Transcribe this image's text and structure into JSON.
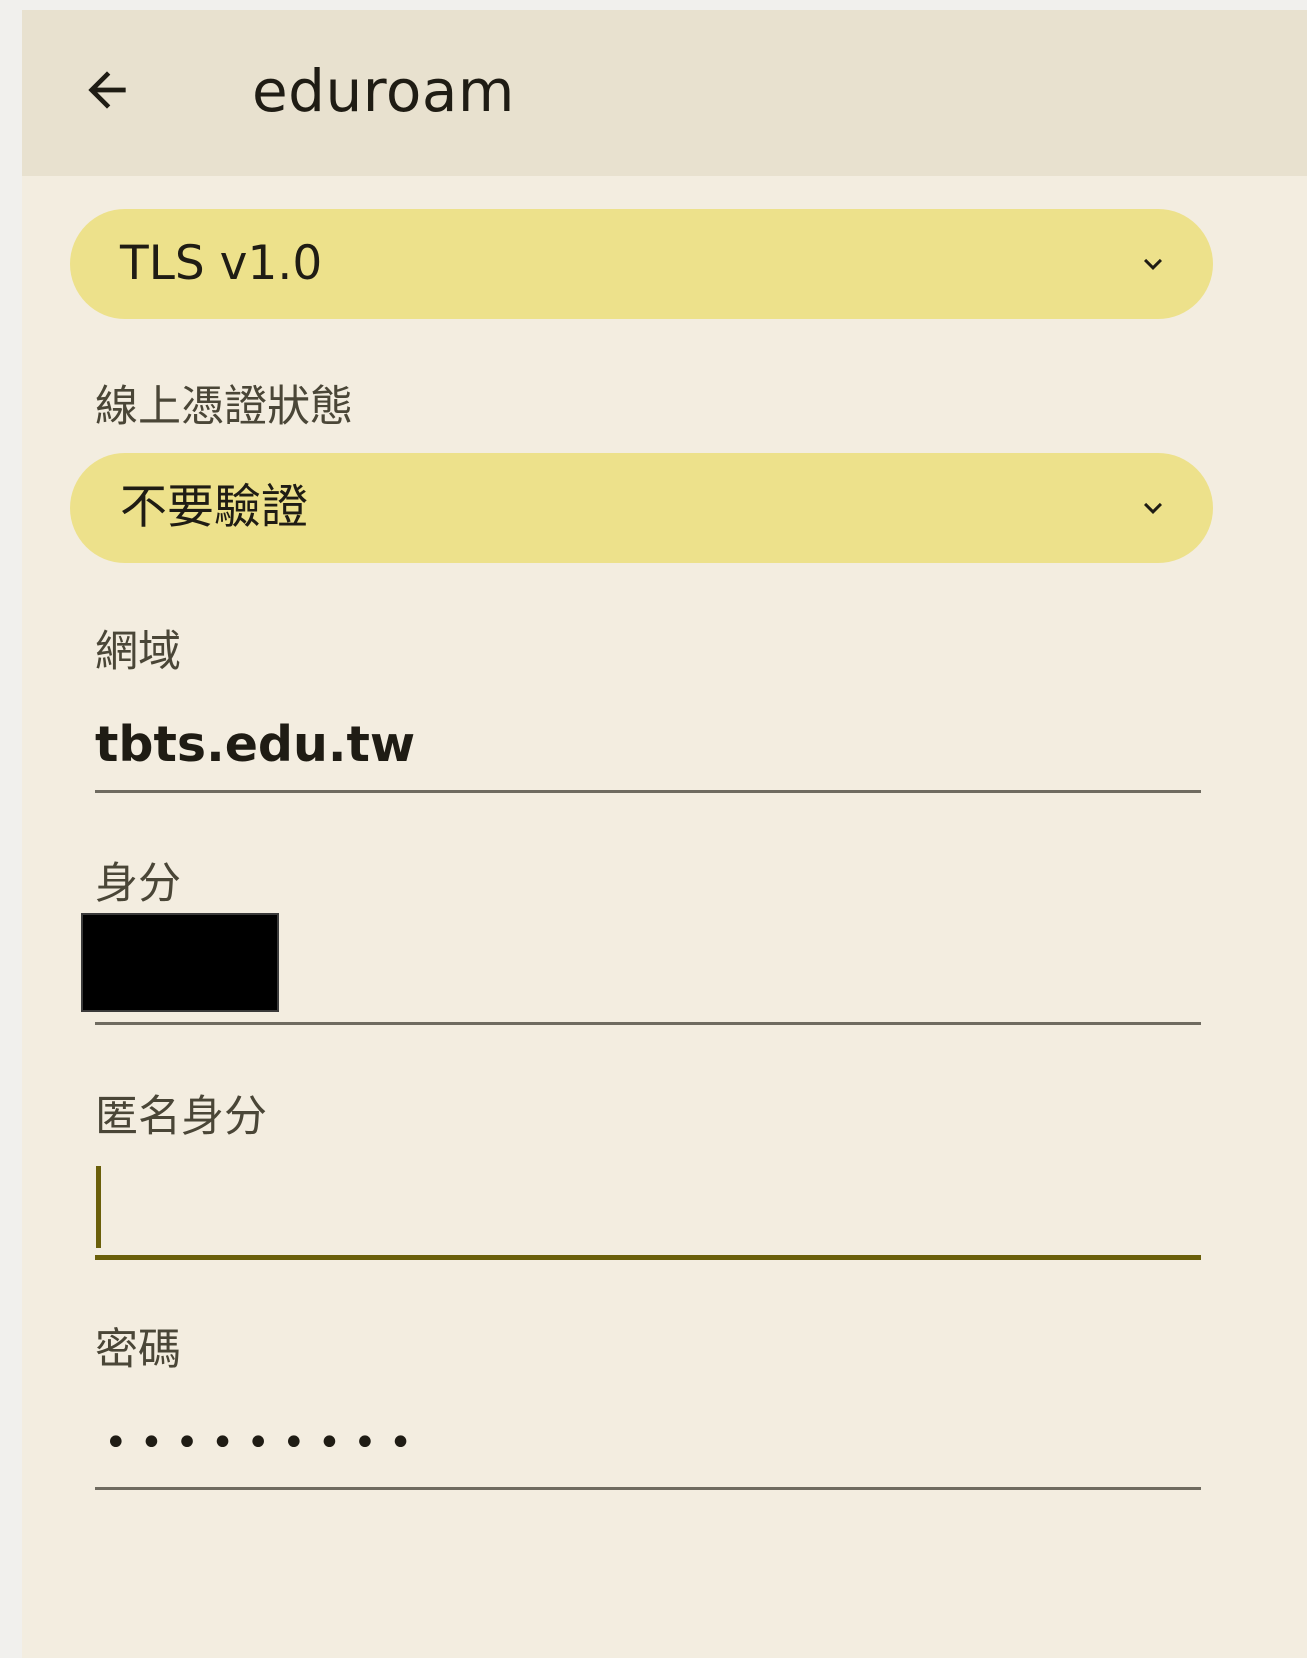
{
  "appbar": {
    "title": "eduroam",
    "back_icon": "arrow-left-icon"
  },
  "tls_dropdown": {
    "value": "TLS v1.0"
  },
  "online_cert_status": {
    "label": "線上憑證狀態",
    "value": "不要驗證"
  },
  "domain": {
    "label": "網域",
    "value": "tbts.edu.tw"
  },
  "identity": {
    "label": "身分"
  },
  "anonymous_identity": {
    "label": "匿名身分",
    "value": ""
  },
  "password": {
    "label": "密碼",
    "value": "•••••••••"
  },
  "colors": {
    "background": "#f3ede0",
    "appbar": "#e8e1cf",
    "dropdown_fill": "#ede18b",
    "focus_accent": "#6a5f0a",
    "text": "#1f1c14"
  }
}
